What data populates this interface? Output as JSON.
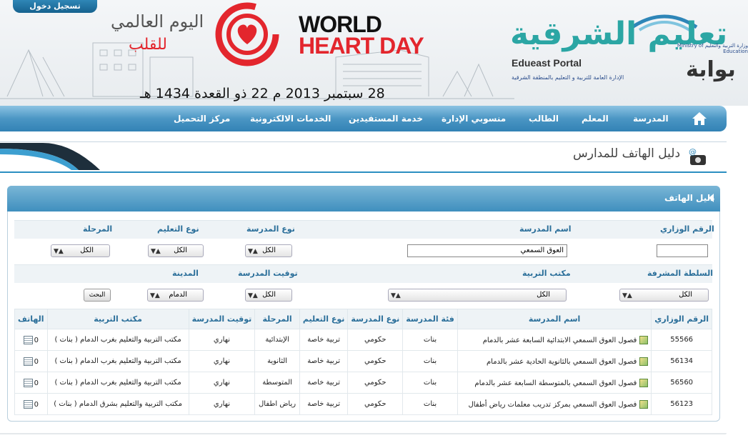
{
  "header": {
    "login_tab": "تسجيل دخول",
    "whd_arabic_1": "اليوم العالمي",
    "whd_arabic_2": "للقلب",
    "whd_english_1": "WORLD",
    "whd_english_2": "HEART DAY",
    "date_line": "28 سبتمبر 2013 م   22 ذو القعدة 1434 هـ",
    "portal_arabic": "تعليم الشرقية",
    "portal_arabic_prefix": "بوابة",
    "portal_english": "Edueast Portal",
    "portal_subtitle": "الإدارة العامة للتربية و التعليم بالمنطقة الشرقية",
    "ministry": "وزارة التربية والتعليم Ministry of Education"
  },
  "nav": {
    "items": [
      "المدرسة",
      "المعلم",
      "الطالب",
      "منسوبي الإدارة",
      "خدمة المستفيدين",
      "الخدمات الالكترونية",
      "مركز التحميل"
    ]
  },
  "page": {
    "title": "دليل الهاتف للمدارس"
  },
  "panel": {
    "title": "دليل الهاتف"
  },
  "filters": {
    "ministry_number_label": "الرقم الوزاري",
    "ministry_number_value": "",
    "school_name_label": "اسم المدرسة",
    "school_name_value": "العوق السمعي",
    "school_type_label": "نوع المدرسة",
    "school_type_value": "الكل",
    "education_type_label": "نوع التعليم",
    "education_type_value": "الكل",
    "stage_label": "المرحلة",
    "stage_value": "الكل",
    "authority_label": "السلطة المشرفة",
    "authority_value": "الكل",
    "office_label": "مكتب التربية",
    "office_value": "الكل",
    "timing_label": "توقيت المدرسة",
    "timing_value": "الكل",
    "city_label": "المدينة",
    "city_value": "الدمام",
    "search_button": "البحث"
  },
  "table": {
    "headers": [
      "الرقم الوزاري",
      "اسم المدرسة",
      "فئة المدرسة",
      "نوع المدرسة",
      "نوع التعليم",
      "المرحلة",
      "توقيت المدرسة",
      "مكتب التربية",
      "الهاتف"
    ],
    "rows": [
      {
        "number": "55566",
        "name": "فصول العوق السمعي الابتدائية السابعة عشر بالدمام",
        "category": "بنات",
        "school_type": "حكومي",
        "education_type": "تربية خاصة",
        "stage": "الإبتدائية",
        "timing": "نهاري",
        "office": "مكتب التربية والتعليم بغرب الدمام ( بنات )",
        "phone": "0"
      },
      {
        "number": "56134",
        "name": "فصول العوق السمعي بالثانوية الحادية عشر بالدمام",
        "category": "بنات",
        "school_type": "حكومي",
        "education_type": "تربية خاصة",
        "stage": "الثانوية",
        "timing": "نهاري",
        "office": "مكتب التربية والتعليم بغرب الدمام ( بنات )",
        "phone": "0"
      },
      {
        "number": "56560",
        "name": "فصول العوق السمعي بالمتوسطة السابعة عشر بالدمام",
        "category": "بنات",
        "school_type": "حكومي",
        "education_type": "تربية خاصة",
        "stage": "المتوسطة",
        "timing": "نهاري",
        "office": "مكتب التربية والتعليم بغرب الدمام ( بنات )",
        "phone": "0"
      },
      {
        "number": "56123",
        "name": "فصول العوق السمعي بمركز تدريب معلمات رياض أطفال",
        "category": "بنات",
        "school_type": "حكومي",
        "education_type": "تربية خاصة",
        "stage": "رياض اطفال",
        "timing": "نهاري",
        "office": "مكتب التربية والتعليم بشرق الدمام ( بنات )",
        "phone": "0"
      }
    ]
  },
  "colors": {
    "nav_blue": "#3282b5",
    "label_blue": "#2b6f9a",
    "heart_red": "#e3262d",
    "portal_teal": "#2ba6a4"
  }
}
